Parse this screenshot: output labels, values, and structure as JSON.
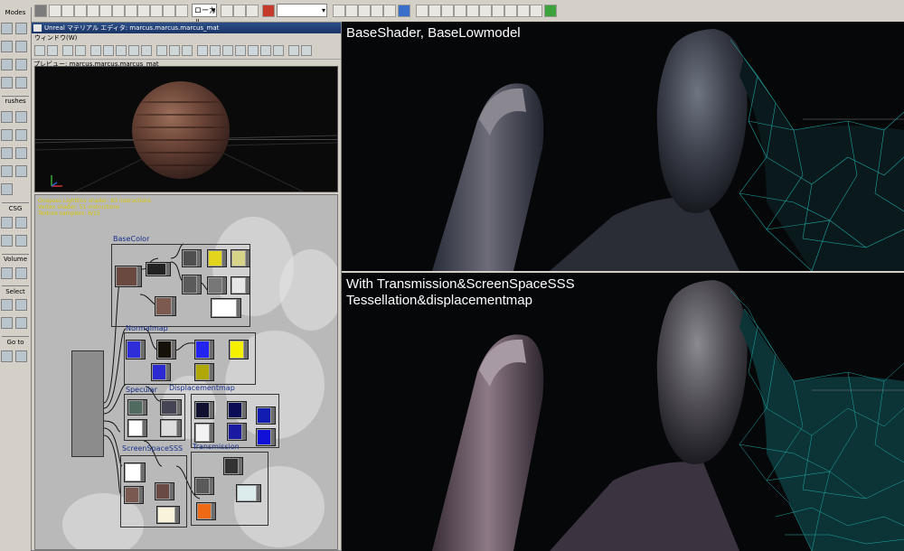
{
  "toolbar": {
    "coord_dropdown": "ローカル",
    "extra_dropdown": ""
  },
  "modes_panel": {
    "title": "Modes",
    "sections": [
      "rushes",
      "CSG",
      "Volume",
      "Select",
      "Go to"
    ]
  },
  "material_editor": {
    "title": "Unreal マテリアル エディタ: marcus.marcus.marcus_mat",
    "menu": "ウィンドウ(W)",
    "preview_label": "プレビュー: marcus.marcus.marcus_mat",
    "shader_info": [
      "Onepass LightEnv shader: 83 instructions",
      "Vertex shader: 51 instructions",
      "Texture samplers: 6/15"
    ],
    "groups": {
      "base_color": "BaseColor",
      "normal_map": "Normalmap",
      "specular": "Specular",
      "displacement": "Displacementmap",
      "sss": "ScreenSpaceSSS",
      "transmission": "Transmission"
    }
  },
  "render": {
    "top_caption": "BaseShader, BaseLowmodel",
    "bottom_caption_line1": "With Transmission&ScreenSpaceSSS",
    "bottom_caption_line2": "Tessellation&displacementmap",
    "wireframe_color": "#1fb3b0"
  },
  "colors": {
    "chrome": "#d4d0c8",
    "title_bar": "#1b3566",
    "group_label": "#1a2f8a"
  }
}
